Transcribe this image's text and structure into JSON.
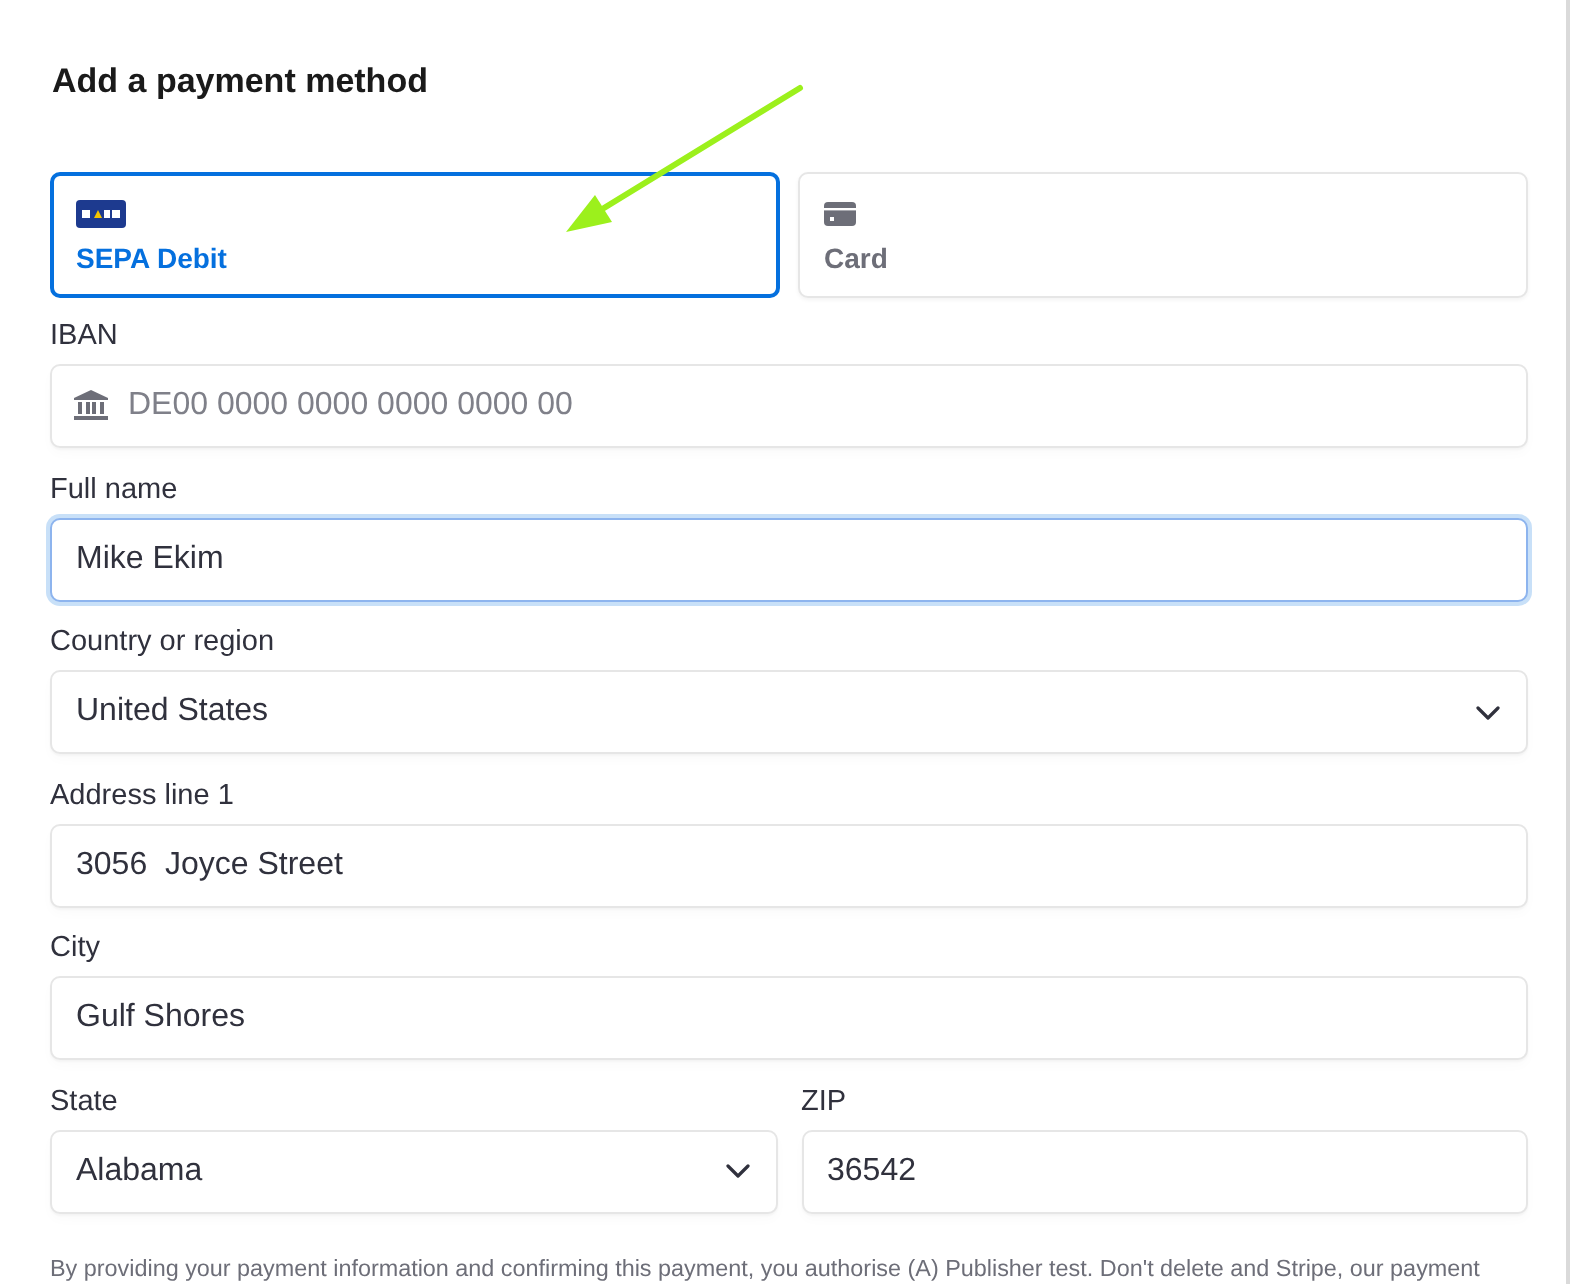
{
  "title": "Add a payment method",
  "payment_methods": [
    {
      "kind": "sepa",
      "label": "SEPA Debit",
      "selected": true
    },
    {
      "kind": "card",
      "label": "Card",
      "selected": false
    }
  ],
  "rows": [
    {
      "fields": [
        {
          "kind": "iban",
          "label": "IBAN",
          "placeholder": "DE00 0000 0000 0000 0000 00",
          "focused": false
        }
      ]
    },
    {
      "fields": [
        {
          "kind": "text",
          "label": "Full name",
          "value": "Mike Ekim",
          "focused": true
        }
      ]
    },
    {
      "fields": [
        {
          "kind": "select",
          "label": "Country or region",
          "value": "United States",
          "focused": false
        }
      ]
    },
    {
      "fields": [
        {
          "kind": "text",
          "label": "Address line 1",
          "value": "3056  Joyce Street",
          "focused": false
        }
      ]
    },
    {
      "fields": [
        {
          "kind": "text",
          "label": "City",
          "value": "Gulf Shores",
          "focused": false
        }
      ]
    },
    {
      "fields": [
        {
          "kind": "select",
          "label": "State",
          "value": "Alabama",
          "focused": false
        },
        {
          "kind": "text",
          "label": "ZIP",
          "value": "36542",
          "focused": false
        }
      ]
    }
  ],
  "disclaimer": "By providing your payment information and confirming this payment, you authorise (A) Publisher test. Don't delete and Stripe, our payment"
}
